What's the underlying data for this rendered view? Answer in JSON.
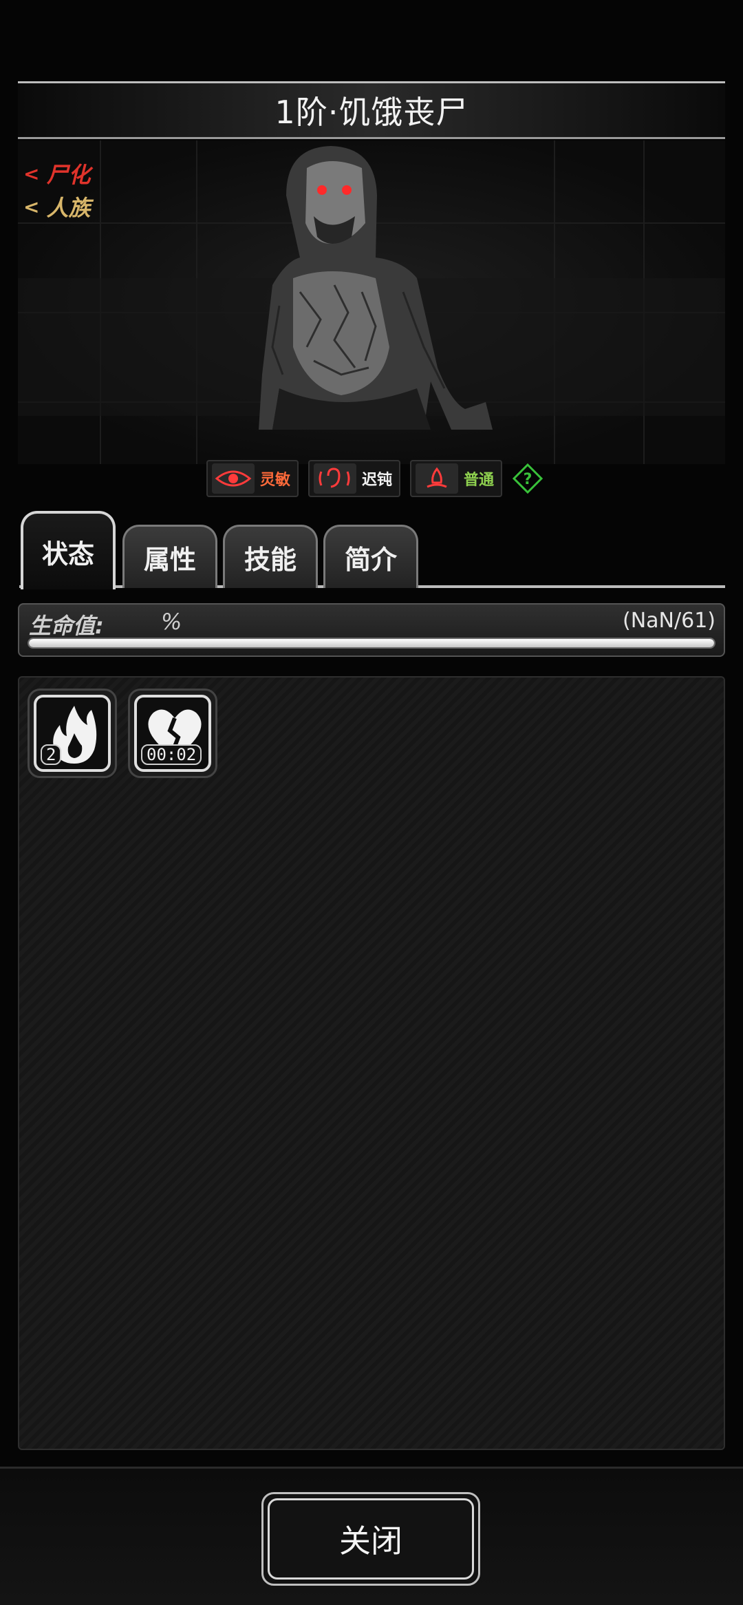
{
  "monster": {
    "title": "1阶·饥饿丧尸",
    "tags": [
      {
        "label": "尸化",
        "color": "#e0332b"
      },
      {
        "label": "人族",
        "color": "#d8b66a"
      }
    ],
    "traits": [
      {
        "label": "灵敏",
        "icon": "eye-icon",
        "color": "#ff6a3a"
      },
      {
        "label": "迟钝",
        "icon": "ear-icon",
        "color": "#f2f2f2"
      },
      {
        "label": "普通",
        "icon": "nose-icon",
        "color": "#8fd14f"
      }
    ],
    "help_icon": "question-diamond-icon"
  },
  "tabs": [
    {
      "label": "状态",
      "active": true
    },
    {
      "label": "属性",
      "active": false
    },
    {
      "label": "技能",
      "active": false
    },
    {
      "label": "简介",
      "active": false
    }
  ],
  "hp": {
    "label": "生命值:",
    "percent_text": "%",
    "value_text": "(NaN/61)",
    "fill_fraction": 1.0
  },
  "status_effects": [
    {
      "icon": "flame-icon",
      "badge": "2"
    },
    {
      "icon": "broken-heart-icon",
      "badge": "00:02"
    }
  ],
  "footer": {
    "close_label": "关闭"
  }
}
